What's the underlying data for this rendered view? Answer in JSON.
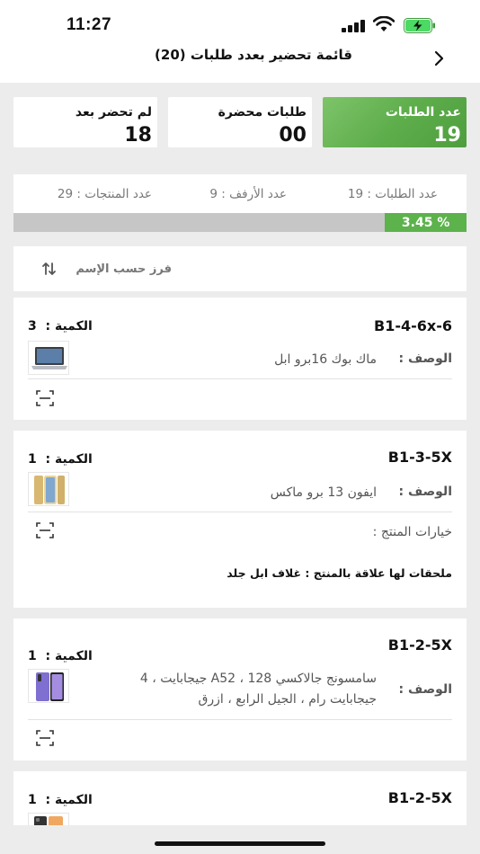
{
  "status_bar": {
    "time": "11:27"
  },
  "nav": {
    "title": "قائمة تحضير بعدد طلبات (20)"
  },
  "stats": [
    {
      "label": "عدد الطلبات",
      "value": "19",
      "highlight": true
    },
    {
      "label": "طلبات محضرة",
      "value": "00"
    },
    {
      "label": "لم تحضر بعد",
      "value": "18"
    }
  ],
  "summary": {
    "orders_count": "عدد الطلبات :  19",
    "shelves_count": "عدد الأرفف :  9",
    "products_count": "عدد المنتجات : 29",
    "progress_text": "% 3.45",
    "progress_percent": 3.45
  },
  "sort": {
    "label": "فرز حسب الإسم"
  },
  "labels": {
    "quantity": "الكمية :",
    "description": "الوصف :",
    "product_options": "خيارات المنتج :"
  },
  "products": [
    {
      "code": "B1-4-6x-6",
      "quantity": "3",
      "description": "ماك بوك 16برو ابل",
      "thumbnail": "laptop"
    },
    {
      "code": "B1-3-5X",
      "quantity": "1",
      "description": "ايفون 13 برو ماكس",
      "thumbnail": "iphone",
      "accessories": "ملحقات لها علاقة بالمنتج  :  غلاف ابل جلد"
    },
    {
      "code": "B1-2-5X",
      "quantity": "1",
      "description": "سامسونج جالاكسي A52 ، 128 جيجابايت ، 4 جيجابايت رام ، الجيل الرابع ، ازرق",
      "thumbnail": "galaxy"
    },
    {
      "code": "B1-2-5X",
      "quantity": "1",
      "thumbnail": "phone-orange"
    }
  ],
  "colors": {
    "accent_green": "#5cb24b",
    "background": "#ececec"
  }
}
